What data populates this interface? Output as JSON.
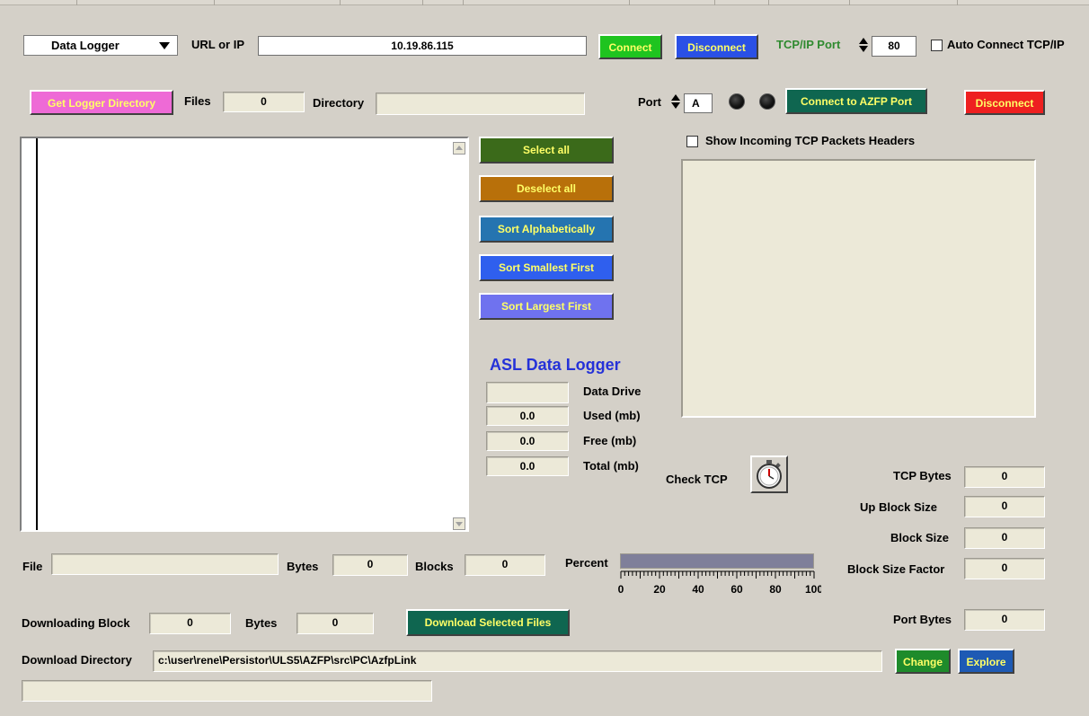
{
  "device_select": {
    "value": "Data Logger"
  },
  "url": {
    "label": "URL or IP",
    "value": "10.19.86.115"
  },
  "buttons": {
    "connect": "Connect",
    "disconnect": "Disconnect",
    "get_logger_directory": "Get Logger Directory",
    "connect_azfp": "Connect to AZFP Port",
    "disconnect_port": "Disconnect",
    "select_all": "Select all",
    "deselect_all": "Deselect all",
    "sort_alpha": "Sort Alphabetically",
    "sort_smallest": "Sort Smallest First",
    "sort_largest": "Sort Largest First",
    "download_selected": "Download Selected Files",
    "change": "Change",
    "explore": "Explore"
  },
  "tcp_port": {
    "label": "TCP/IP Port",
    "value": "80"
  },
  "auto_connect": {
    "label": "Auto Connect TCP/IP",
    "checked": false
  },
  "files": {
    "label": "Files",
    "value": "0"
  },
  "directory": {
    "label": "Directory",
    "value": ""
  },
  "port": {
    "label": "Port",
    "value": "A"
  },
  "show_headers": {
    "label": "Show Incoming TCP Packets Headers",
    "checked": false
  },
  "logger": {
    "title": "ASL Data Logger",
    "data_drive": {
      "label": "Data Drive",
      "value": ""
    },
    "used": {
      "label": "Used (mb)",
      "value": "0.0"
    },
    "free": {
      "label": "Free (mb)",
      "value": "0.0"
    },
    "total": {
      "label": "Total (mb)",
      "value": "0.0"
    }
  },
  "check_tcp": {
    "label": "Check TCP",
    "icon": "stopwatch-icon"
  },
  "stats": {
    "tcp_bytes": {
      "label": "TCP Bytes",
      "value": "0"
    },
    "up_block_size": {
      "label": "Up Block Size",
      "value": "0"
    },
    "block_size": {
      "label": "Block Size",
      "value": "0"
    },
    "block_size_factor": {
      "label": "Block Size Factor",
      "value": "0"
    },
    "port_bytes": {
      "label": "Port Bytes",
      "value": "0"
    }
  },
  "file_row": {
    "file_label": "File",
    "file_value": "",
    "bytes_label": "Bytes",
    "bytes_value": "0",
    "blocks_label": "Blocks",
    "blocks_value": "0",
    "percent_label": "Percent",
    "percent_value": 1.0,
    "scale_ticks": [
      "0",
      "20",
      "40",
      "60",
      "80",
      "100"
    ]
  },
  "downloading": {
    "block_label": "Downloading Block",
    "block_value": "0",
    "bytes_label": "Bytes",
    "bytes_value": "0"
  },
  "download_dir": {
    "label": "Download Directory",
    "value": "c:\\user\\rene\\Persistor\\ULS5\\AZFP\\src\\PC\\AzfpLink"
  },
  "status_bar": {
    "value": ""
  },
  "colors": {
    "connect": "#1fc41f",
    "disconnect": "#2a50e6",
    "get_logger": "#ee6ad6",
    "connect_azfp": "#0f6650",
    "disconnect_port": "#ee2020",
    "select_all": "#3b6a1a",
    "deselect_all": "#b8700a",
    "sort_alpha": "#2574b0",
    "sort_smallest": "#2f5fee",
    "sort_largest": "#6f72ef",
    "download": "#0f6650",
    "change": "#1e8b2b",
    "explore": "#1e5ab4",
    "tcp_label": "#2f8a2f",
    "logger_title": "#2532d8",
    "progress": "#7f7f9a"
  }
}
